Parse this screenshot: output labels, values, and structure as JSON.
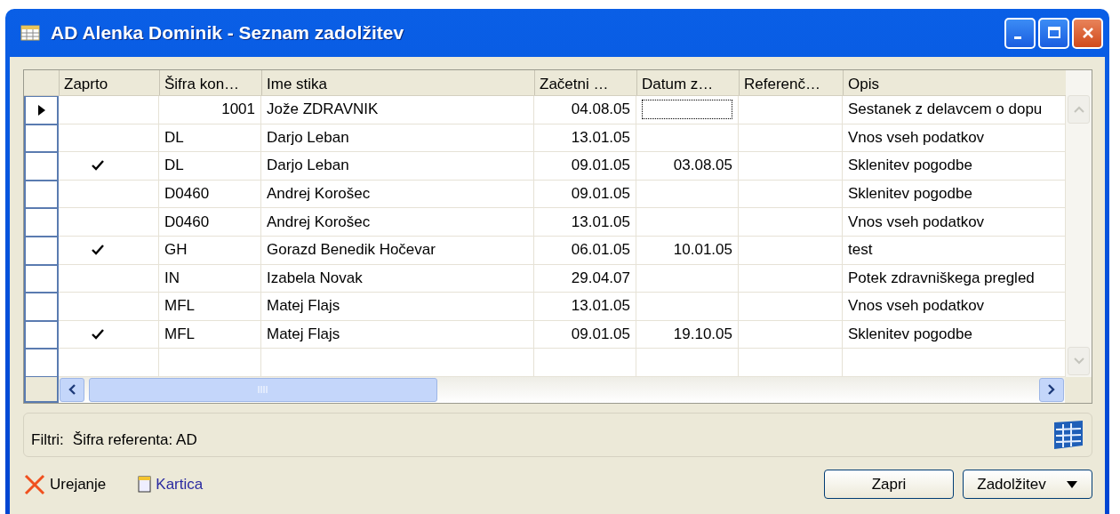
{
  "window": {
    "title": "AD Alenka Dominik - Seznam zadolžitev"
  },
  "table": {
    "columns": [
      "Zaprto",
      "Šifra kon…",
      "Ime stika",
      "Začetni …",
      "Datum z…",
      "Referenč…",
      "Opis"
    ],
    "rows": [
      {
        "selected": true,
        "closed": false,
        "code": "1001",
        "name": "Jože ZDRAVNIK",
        "start": "04.08.05",
        "date": "",
        "opis": "Sestanek z delavcem o dopu"
      },
      {
        "selected": false,
        "closed": false,
        "code": "DL",
        "name": "Darjo Leban",
        "start": "13.01.05",
        "date": "",
        "opis": "Vnos vseh podatkov"
      },
      {
        "selected": false,
        "closed": true,
        "code": "DL",
        "name": "Darjo Leban",
        "start": "09.01.05",
        "date": "03.08.05",
        "opis": "Sklenitev pogodbe"
      },
      {
        "selected": false,
        "closed": false,
        "code": "D0460",
        "name": "Andrej Korošec",
        "start": "09.01.05",
        "date": "",
        "opis": "Sklenitev pogodbe"
      },
      {
        "selected": false,
        "closed": false,
        "code": "D0460",
        "name": "Andrej Korošec",
        "start": "13.01.05",
        "date": "",
        "opis": "Vnos vseh podatkov"
      },
      {
        "selected": false,
        "closed": true,
        "code": "GH",
        "name": "Gorazd Benedik Hočevar",
        "start": "06.01.05",
        "date": "10.01.05",
        "opis": "test"
      },
      {
        "selected": false,
        "closed": false,
        "code": "IN",
        "name": "Izabela Novak",
        "start": "29.04.07",
        "date": "",
        "opis": "Potek zdravniškega pregled"
      },
      {
        "selected": false,
        "closed": false,
        "code": "MFL",
        "name": "Matej Flajs",
        "start": "13.01.05",
        "date": "",
        "opis": "Vnos vseh podatkov"
      },
      {
        "selected": false,
        "closed": true,
        "code": "MFL",
        "name": "Matej Flajs",
        "start": "09.01.05",
        "date": "19.10.05",
        "opis": "Sklenitev pogodbe"
      }
    ]
  },
  "filter": {
    "label": "Filtri:",
    "value": "Šifra referenta: AD"
  },
  "links": [
    {
      "kind": "delete",
      "label": "Urejanje"
    },
    {
      "kind": "card",
      "label": "Kartica"
    }
  ],
  "buttons": [
    {
      "kind": "plain",
      "label": "Zapri"
    },
    {
      "kind": "menu",
      "label": "Zadolžitev"
    }
  ]
}
